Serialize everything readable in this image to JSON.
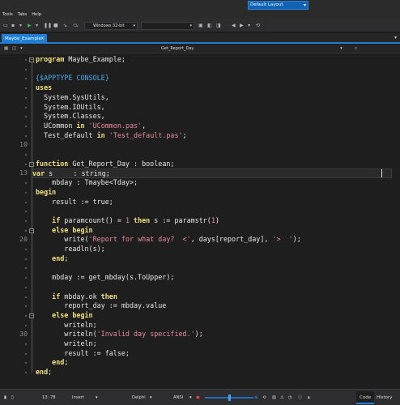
{
  "layout_select": {
    "label": "Default Layout"
  },
  "menu": [
    "Tools",
    "Tabs",
    "Help"
  ],
  "toolbar": {
    "platform": "Windows 32-bit"
  },
  "tab": {
    "label": "Maybe_Example"
  },
  "navbar": {
    "method": "Get_Report_Day"
  },
  "gutter_labels": [
    {
      "row": 1,
      "text": "10"
    },
    {
      "row": 2,
      "text": "13"
    },
    {
      "row": 3,
      "text": "20"
    },
    {
      "row": 4,
      "text": "30"
    }
  ],
  "code_lines": [
    "program Maybe_Example;",
    "",
    "{$APPTYPE CONSOLE}",
    "uses",
    "  System.SysUtils,",
    "  System.IOUtils,",
    "  System.Classes,",
    "  UCommon in 'UCommon.pas',",
    "  Test_default in 'Test_default.pas';",
    "",
    "",
    "function Get_Report_Day : boolean;",
    "var s     : string;",
    "    mbday : Tmaybe<Tday>;",
    "begin",
    "    result := true;",
    "",
    "    if paramcount() = 1 then s := paramstr(1)",
    "    else begin",
    "       write('Report for what day?  <', days[report_day], '>  ');",
    "       readln(s);",
    "    end;",
    "",
    "    mbday := get_mbday(s.ToUpper);",
    "",
    "    if mbday.ok then",
    "       report_day := mbday.value",
    "    else begin",
    "       writeln;",
    "       writeln('Invalid day specified.');",
    "       writeln;",
    "       result := false;",
    "    end;",
    "end;"
  ],
  "status": {
    "position": "13: 78",
    "mode": "Insert",
    "language": "Delphi",
    "encoding": "ANSI",
    "tab_code": "Code",
    "tab_history": "History"
  }
}
